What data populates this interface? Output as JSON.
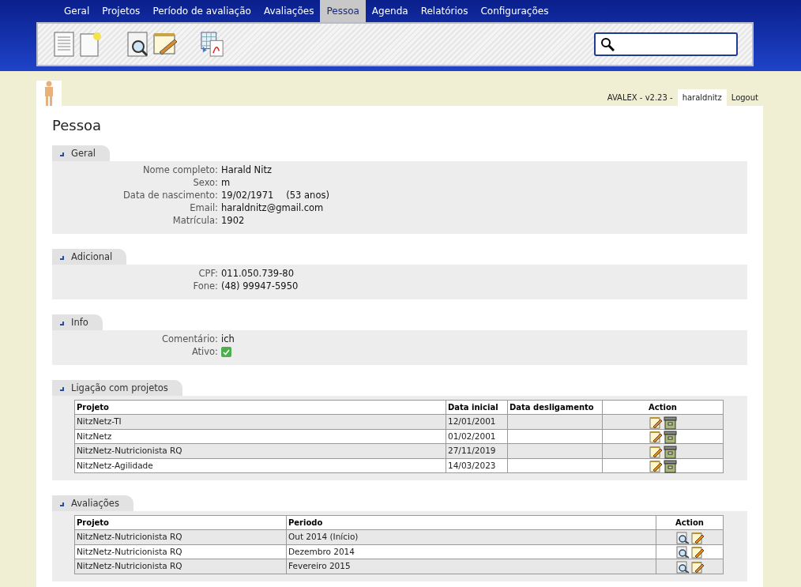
{
  "nav": {
    "tabs": [
      {
        "label": "Geral",
        "selected": false
      },
      {
        "label": "Projetos",
        "selected": false
      },
      {
        "label": "Período de avaliação",
        "selected": false
      },
      {
        "label": "Avaliações",
        "selected": false
      },
      {
        "label": "Pessoa",
        "selected": true
      },
      {
        "label": "Agenda",
        "selected": false
      },
      {
        "label": "Relatórios",
        "selected": false
      },
      {
        "label": "Configurações",
        "selected": false
      }
    ]
  },
  "toolbar": {
    "groups": [
      [
        {
          "kind": "document"
        },
        {
          "kind": "new-document"
        }
      ],
      [
        {
          "kind": "search-document"
        },
        {
          "kind": "notepad"
        }
      ],
      [
        {
          "kind": "export"
        }
      ]
    ]
  },
  "header": {
    "version": "AVALEX - v2.23 -",
    "user": "haraldnitz",
    "logout": "Logout"
  },
  "page_title": "Pessoa",
  "sections": [
    {
      "title": "Geral",
      "kind": "fields",
      "fields": [
        {
          "label": "Nome completo:",
          "value": "Harald Nitz"
        },
        {
          "label": "Sexo:",
          "value": "m"
        },
        {
          "label": "Data de nascimento:",
          "value": "19/02/1971",
          "extra": "(53 anos)"
        },
        {
          "label": "Email:",
          "value": "haraldnitz@gmail.com"
        },
        {
          "label": "Matrícula:",
          "value": "1902"
        }
      ]
    },
    {
      "title": "Adicional",
      "kind": "fields",
      "fields": [
        {
          "label": "CPF:",
          "value": "011.050.739-80"
        },
        {
          "label": "Fone:",
          "value": "(48) 99947-5950"
        }
      ]
    },
    {
      "title": "Info",
      "kind": "fields",
      "fields": [
        {
          "label": "Comentário:",
          "value": "ich"
        },
        {
          "label": "Ativo:",
          "checked": true
        }
      ]
    },
    {
      "title": "Ligação com projetos",
      "kind": "links",
      "columns": [
        "Projeto",
        "Data inicial",
        "Data desligamento",
        "Action"
      ],
      "rows": [
        {
          "cells": [
            "NitzNetz-TI",
            "12/01/2001"
          ]
        },
        {
          "cells": [
            "NitzNetz",
            "01/02/2001"
          ]
        },
        {
          "cells": [
            "NitzNetz-Nutricionista RQ",
            "27/11/2019"
          ]
        },
        {
          "cells": [
            "NitzNetz-Agilidade",
            "14/03/2023"
          ]
        }
      ]
    },
    {
      "title": "Avaliações",
      "kind": "reviews",
      "columns": [
        "Projeto",
        "Periodo",
        "Action"
      ],
      "rows": [
        {
          "cells": [
            "NitzNetz-Nutricionista RQ",
            "Out 2014 (Início)"
          ]
        },
        {
          "cells": [
            "NitzNetz-Nutricionista RQ",
            "Dezembro 2014"
          ]
        },
        {
          "cells": [
            "NitzNetz-Nutricionista RQ",
            "Fevereiro 2015"
          ]
        }
      ]
    }
  ]
}
